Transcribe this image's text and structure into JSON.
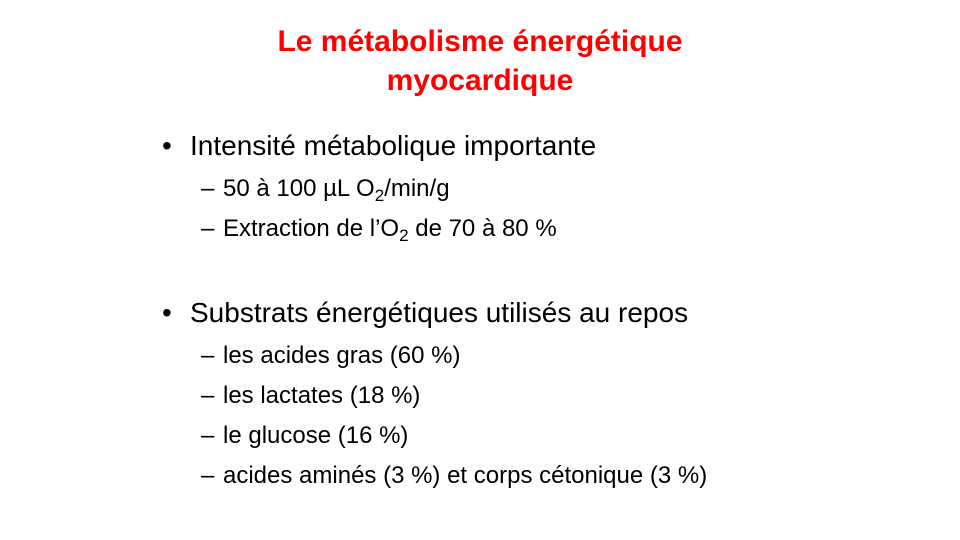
{
  "slide": {
    "title_line1": "Le métabolisme énergétique",
    "title_line2": "myocardique",
    "title_color": "#ff0000",
    "bullet_symbol": "•",
    "dash_symbol": "–",
    "sections": [
      {
        "heading": "Intensité métabolique importante",
        "items": [
          {
            "before": "50 à 100 µL O",
            "sub": "2",
            "after": "/min/g"
          },
          {
            "before": "Extraction de l’O",
            "sub": "2",
            "after": " de 70 à 80 %"
          }
        ]
      },
      {
        "heading": "Substrats énergétiques utilisés au repos",
        "items": [
          {
            "text": "les acides gras (60 %)"
          },
          {
            "text": "les lactates (18 %)"
          },
          {
            "text": "le glucose (16 %)"
          },
          {
            "text": "acides aminés (3 %) et corps cétonique (3 %)"
          }
        ]
      }
    ]
  }
}
